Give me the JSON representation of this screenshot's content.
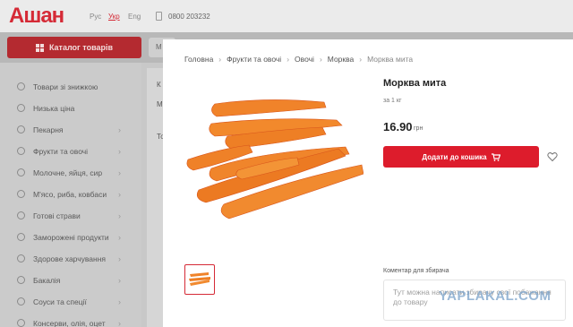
{
  "header": {
    "logo": "Ашан",
    "languages": [
      "Рус",
      "Укр",
      "Eng"
    ],
    "active_language": "Укр",
    "phone": "0800 203232",
    "brand_color": "#d52a36"
  },
  "navbar": {
    "catalog_label": "Каталог товарів",
    "search_stub": "М"
  },
  "sidebar": {
    "items": [
      {
        "label": "Товари зі знижкою",
        "icon": "discount-icon"
      },
      {
        "label": "Низька ціна",
        "icon": "tag-icon"
      },
      {
        "label": "Пекарня",
        "icon": "bread-icon"
      },
      {
        "label": "Фрукти та овочі",
        "icon": "apple-icon"
      },
      {
        "label": "Молочне, яйця, сир",
        "icon": "milk-icon"
      },
      {
        "label": "М'ясо, риба, ковбаси",
        "icon": "meat-icon"
      },
      {
        "label": "Готові страви",
        "icon": "dish-icon"
      },
      {
        "label": "Заморожені продукти",
        "icon": "snowflake-icon"
      },
      {
        "label": "Здорове харчування",
        "icon": "leaf-icon"
      },
      {
        "label": "Бакалія",
        "icon": "jar-icon"
      },
      {
        "label": "Соуси та спеції",
        "icon": "sauce-icon"
      },
      {
        "label": "Консерви, олія, оцет",
        "icon": "can-icon"
      }
    ]
  },
  "background_column": [
    "К",
    "М",
    "То"
  ],
  "modal": {
    "breadcrumb": [
      "Головна",
      "Фрукти та овочі",
      "Овочі",
      "Морква",
      "Морква мита"
    ],
    "title": "Морква мита",
    "weight": "за 1 кг",
    "price": "16.90",
    "currency": "грн",
    "add_button_label": "Додати до кошика",
    "comment_label": "Коментар для збирача",
    "comment_placeholder": "Тут можна написати збирачу свої побажання до товару",
    "button_color": "#dd1c2c"
  },
  "watermark": "YAPLAKAL.COM"
}
